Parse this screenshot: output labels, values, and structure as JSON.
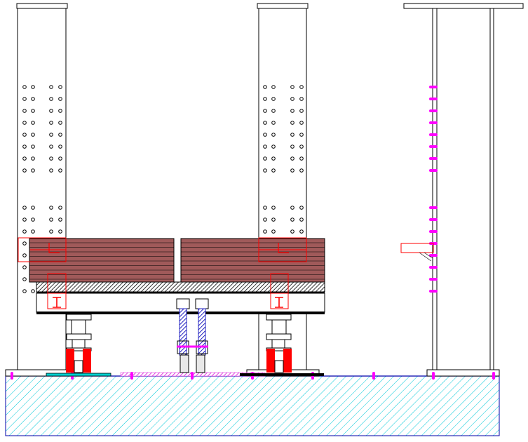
{
  "drawing": {
    "colors": {
      "background": "#ffffff",
      "line": "#000000",
      "timber": "#a05a5a",
      "bolt": "#ff00ff",
      "bracket": "#ff0000",
      "foundation_hatch": "#00c8d8",
      "foundation_border": "#0000aa",
      "hanger": "#2020c0",
      "pad": "#00d0d0"
    },
    "columns": [
      {
        "name": "left-column",
        "hole_pattern": "perforated"
      },
      {
        "name": "middle-column",
        "hole_pattern": "perforated"
      },
      {
        "name": "right-column",
        "hole_pattern": "bolted"
      }
    ],
    "timber_beams": [
      {
        "name": "left-beam"
      },
      {
        "name": "right-beam"
      }
    ],
    "foundation": {
      "name": "concrete-foundation",
      "pattern": "diagonal-hatch"
    },
    "supports": [
      {
        "name": "left-support",
        "style": "red-jack"
      },
      {
        "name": "center-hanger",
        "style": "blue-rod"
      },
      {
        "name": "right-support",
        "style": "red-jack"
      }
    ]
  }
}
